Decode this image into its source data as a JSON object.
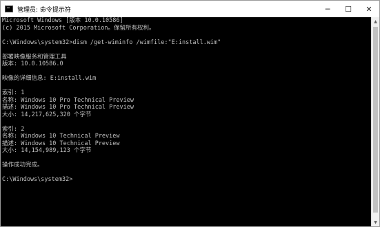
{
  "window": {
    "title": "管理员: 命令提示符",
    "controls": {
      "minimize": "─",
      "maximize": "☐",
      "close": "✕"
    },
    "icons": {
      "app": "cmd-icon",
      "scroll_up": "chevron-up-icon",
      "scroll_down": "chevron-down-icon"
    },
    "scroll_up_glyph": "▲",
    "scroll_down_glyph": "▼"
  },
  "console": {
    "lines": [
      "Microsoft Windows [版本 10.0.10586]",
      "(c) 2015 Microsoft Corporation。保留所有权利。",
      "",
      "C:\\Windows\\system32>dism /get-wiminfo /wimfile:\"E:install.wim\"",
      "",
      "部署映像服务和管理工具",
      "版本: 10.0.10586.0",
      "",
      "映像的详细信息: E:install.wim",
      "",
      "索引: 1",
      "名称: Windows 10 Pro Technical Preview",
      "描述: Windows 10 Pro Technical Preview",
      "大小: 14,217,625,320 个字节",
      "",
      "索引: 2",
      "名称: Windows 10 Technical Preview",
      "描述: Windows 10 Technical Preview",
      "大小: 14,154,989,123 个字节",
      "",
      "操作成功完成。",
      "",
      "C:\\Windows\\system32>"
    ]
  }
}
